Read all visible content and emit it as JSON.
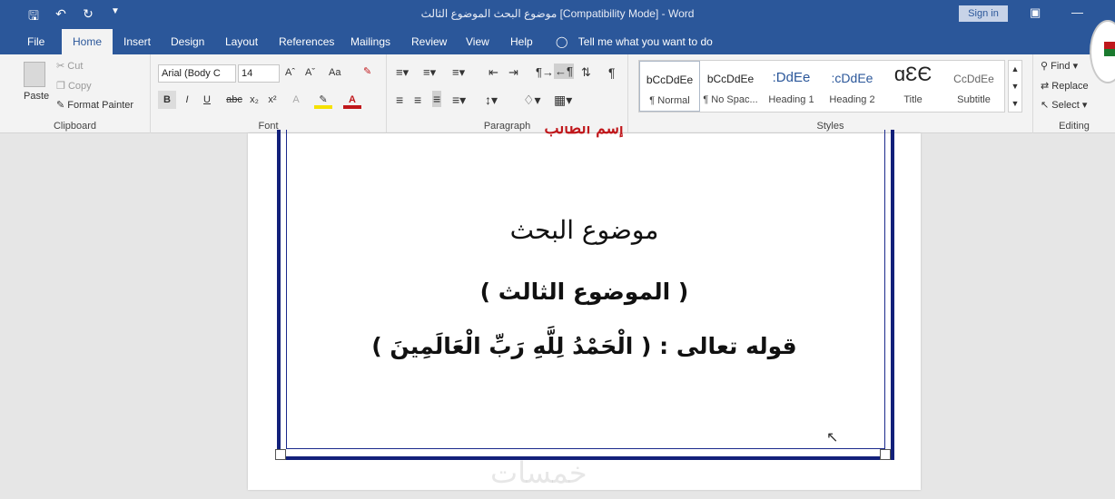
{
  "titlebar": {
    "doc_title": "موضوع البحث الموضوع الثالث [Compatibility Mode]  -  Word",
    "signin": "Sign in",
    "save_icon": "save-icon",
    "undo_icon": "undo-icon",
    "redo_icon": "redo-icon"
  },
  "tabs": {
    "file": "File",
    "home": "Home",
    "insert": "Insert",
    "design": "Design",
    "layout": "Layout",
    "references": "References",
    "mailings": "Mailings",
    "review": "Review",
    "view": "View",
    "help": "Help",
    "tellme": "Tell me what you want to do"
  },
  "clipboard": {
    "paste": "Paste",
    "cut": "Cut",
    "copy": "Copy",
    "format_painter": "Format Painter",
    "label": "Clipboard"
  },
  "font": {
    "name": "Arial (Body C",
    "size": "14",
    "aa": "Aa",
    "bold": "B",
    "italic": "I",
    "underline": "U",
    "strike": "abc",
    "subscript": "x₂",
    "superscript": "x²",
    "font_color": "A",
    "label": "Font"
  },
  "paragraph": {
    "label": "Paragraph"
  },
  "styles": {
    "items": [
      {
        "sample": "bCcDdEe",
        "name": "¶ Normal"
      },
      {
        "sample": "bCcDdEe",
        "name": "¶ No Spac..."
      },
      {
        "sample": ":DdEe",
        "name": "Heading 1"
      },
      {
        "sample": ":cDdEe",
        "name": "Heading 2"
      },
      {
        "sample": "ɑƐЄ",
        "name": "Title"
      },
      {
        "sample": "CcDdEe",
        "name": "Subtitle"
      }
    ],
    "label": "Styles"
  },
  "editing": {
    "find": "Find",
    "replace": "Replace",
    "select": "Select",
    "label": "Editing"
  },
  "document": {
    "red_heading_partial": "إسم الطالب",
    "line1": "موضوع البحث",
    "line2": "( الموضوع الثالث )",
    "line3": "قوله تعالى : ( الْحَمْدُ لِلَّهِ رَبِّ الْعَالَمِينَ )",
    "watermark": "خمسات"
  }
}
